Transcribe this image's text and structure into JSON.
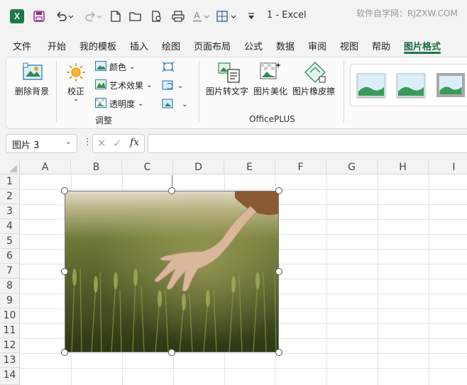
{
  "titlebar": {
    "title": "1  -  Excel",
    "watermark": "软件自学网：RJZXW.COM"
  },
  "menu": {
    "tabs": [
      "文件",
      "开始",
      "我的模板",
      "插入",
      "绘图",
      "页面布局",
      "公式",
      "数据",
      "审阅",
      "视图",
      "帮助",
      "图片格式"
    ],
    "active": "图片格式"
  },
  "ribbon": {
    "remove_bg": "删除背景",
    "correct": "校正",
    "color": "颜色",
    "art_effects": "艺术效果",
    "transparency": "透明度",
    "adjust_group": "调整",
    "pic_to_text": "图片转文字",
    "pic_beautify": "图片美化",
    "pic_eraser": "图片橡皮擦",
    "officeplus_group": "OfficePLUS"
  },
  "formula_bar": {
    "name_box": "图片 3",
    "formula": ""
  },
  "grid": {
    "columns": [
      "A",
      "B",
      "C",
      "D",
      "E",
      "F",
      "G",
      "H",
      "I"
    ],
    "rows": [
      "1",
      "2",
      "3",
      "4",
      "5",
      "6",
      "7",
      "8",
      "9",
      "10",
      "11",
      "12",
      "13",
      "14"
    ]
  },
  "colors": {
    "accent": "#1e7a45",
    "ribbon_bg": "#fbfbfb",
    "window_bg": "#f3f3f3"
  }
}
